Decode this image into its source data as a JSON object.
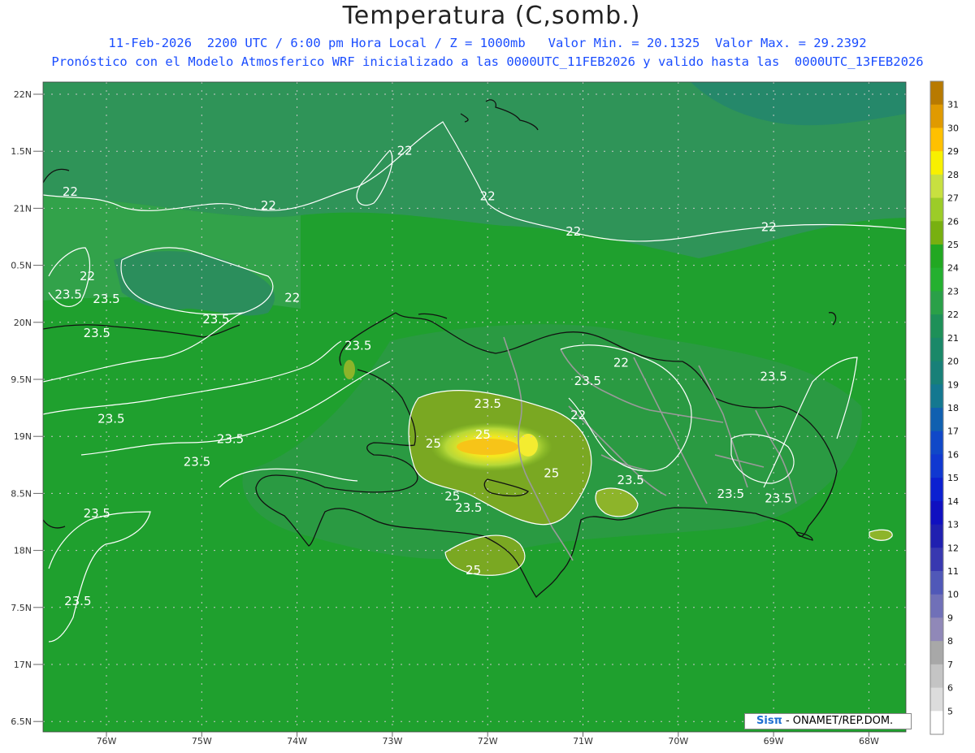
{
  "title": "Temperatura (C,somb.)",
  "subtitle_line1": "11-Feb-2026  2200 UTC / 6:00 pm Hora Local / Z = 1000mb   Valor Min. = 20.1325  Valor Max. = 29.2392",
  "subtitle_line2": "Pronóstico con el Modelo Atmosferico WRF inicializado a las 0000UTC_11FEB2026 y valido hasta las  0000UTC_13FEB2026",
  "credit": {
    "logo": "Sisπ",
    "text": " - ONAMET/REP.DOM."
  },
  "lat_labels": [
    "22N",
    "1.5N",
    "21N",
    "0.5N",
    "20N",
    "9.5N",
    "19N",
    "8.5N",
    "18N",
    "7.5N",
    "17N",
    "6.5N"
  ],
  "lon_labels": [
    "76W",
    "75W",
    "74W",
    "73W",
    "72W",
    "71W",
    "70W",
    "69W",
    "68W"
  ],
  "colorbar": {
    "labels": [
      "31",
      "30",
      "29",
      "28",
      "27",
      "26",
      "25",
      "24",
      "23",
      "22",
      "21",
      "20",
      "19",
      "18",
      "17",
      "16",
      "15",
      "14",
      "13",
      "12",
      "11",
      "10",
      "9",
      "8",
      "7",
      "6",
      "5"
    ],
    "colors": [
      "#b87a00",
      "#e09a00",
      "#ffc000",
      "#f8f000",
      "#c8e040",
      "#9ccc28",
      "#78b010",
      "#22a822",
      "#24b030",
      "#2aa048",
      "#1e9058",
      "#1a8868",
      "#188078",
      "#147890",
      "#1060b0",
      "#1048c8",
      "#1038d0",
      "#0c20d0",
      "#1010c0",
      "#2020b0",
      "#3838b0",
      "#5058b8",
      "#7070b8",
      "#9088b8",
      "#a8a8a8",
      "#c4c4c4",
      "#dcdcdc",
      "#ffffff"
    ]
  },
  "contour_labels": [
    {
      "text": "22",
      "lon": -76.38,
      "lat": 21.11
    },
    {
      "text": "22",
      "lon": -72.87,
      "lat": 21.47
    },
    {
      "text": "22",
      "lon": -72.0,
      "lat": 21.07
    },
    {
      "text": "22",
      "lon": -74.3,
      "lat": 20.99
    },
    {
      "text": "22",
      "lon": -71.1,
      "lat": 20.76
    },
    {
      "text": "22",
      "lon": -69.05,
      "lat": 20.8
    },
    {
      "text": "22",
      "lon": -76.2,
      "lat": 20.37
    },
    {
      "text": "22",
      "lon": -74.05,
      "lat": 20.18
    },
    {
      "text": "22",
      "lon": -70.6,
      "lat": 19.61
    },
    {
      "text": "22",
      "lon": -71.05,
      "lat": 19.15
    },
    {
      "text": "23.5",
      "lon": -76.4,
      "lat": 20.21
    },
    {
      "text": "23.5",
      "lon": -76.0,
      "lat": 20.17
    },
    {
      "text": "23.5",
      "lon": -74.85,
      "lat": 19.99
    },
    {
      "text": "23.5",
      "lon": -76.1,
      "lat": 19.87
    },
    {
      "text": "23.5",
      "lon": -73.36,
      "lat": 19.76
    },
    {
      "text": "23.5",
      "lon": -70.95,
      "lat": 19.45
    },
    {
      "text": "23.5",
      "lon": -72.0,
      "lat": 19.25
    },
    {
      "text": "23.5",
      "lon": -75.95,
      "lat": 19.12
    },
    {
      "text": "23.5",
      "lon": -74.7,
      "lat": 18.94
    },
    {
      "text": "23.5",
      "lon": -75.05,
      "lat": 18.74
    },
    {
      "text": "23.5",
      "lon": -70.5,
      "lat": 18.58
    },
    {
      "text": "23.5",
      "lon": -69.45,
      "lat": 18.46
    },
    {
      "text": "23.5",
      "lon": -68.95,
      "lat": 18.42
    },
    {
      "text": "23.5",
      "lon": -72.2,
      "lat": 18.34
    },
    {
      "text": "23.5",
      "lon": -76.1,
      "lat": 18.29
    },
    {
      "text": "23.5",
      "lon": -69.0,
      "lat": 19.49
    },
    {
      "text": "23.5",
      "lon": -76.3,
      "lat": 17.52
    },
    {
      "text": "25",
      "lon": -72.57,
      "lat": 18.9
    },
    {
      "text": "25",
      "lon": -72.05,
      "lat": 18.98
    },
    {
      "text": "25",
      "lon": -71.33,
      "lat": 18.64
    },
    {
      "text": "25",
      "lon": -72.37,
      "lat": 18.44
    },
    {
      "text": "25",
      "lon": -72.15,
      "lat": 17.79
    }
  ],
  "wrf_cities": []
}
